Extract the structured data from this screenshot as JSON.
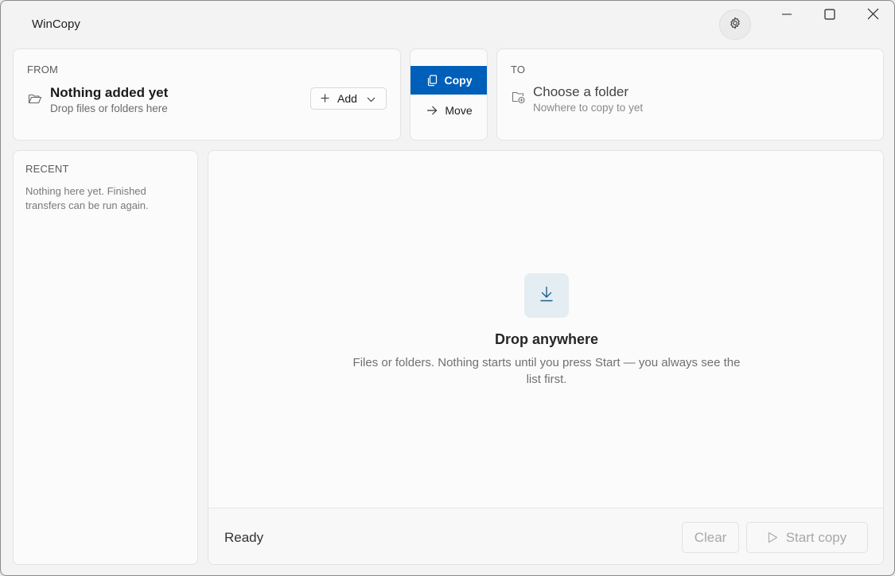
{
  "app": {
    "title": "WinCopy"
  },
  "from": {
    "label": "FROM",
    "title": "Nothing added yet",
    "subtitle": "Drop files or folders here",
    "add_label": "Add",
    "icon": "folder-open-icon"
  },
  "mode": {
    "copy_label": "Copy",
    "move_label": "Move",
    "selected": "Copy",
    "accent": "#005fb8"
  },
  "to": {
    "label": "TO",
    "title": "Choose a folder",
    "subtitle": "Nowhere to copy to yet",
    "icon": "folder-add-icon"
  },
  "recent": {
    "label": "RECENT",
    "empty_text": "Nothing here yet. Finished transfers can be run again."
  },
  "dropzone": {
    "title": "Drop anywhere",
    "description": "Files or folders. Nothing starts until you press Start — you always see the list first.",
    "icon": "download-arrow-icon"
  },
  "footer": {
    "status": "Ready",
    "clear_label": "Clear",
    "start_label": "Start copy"
  }
}
